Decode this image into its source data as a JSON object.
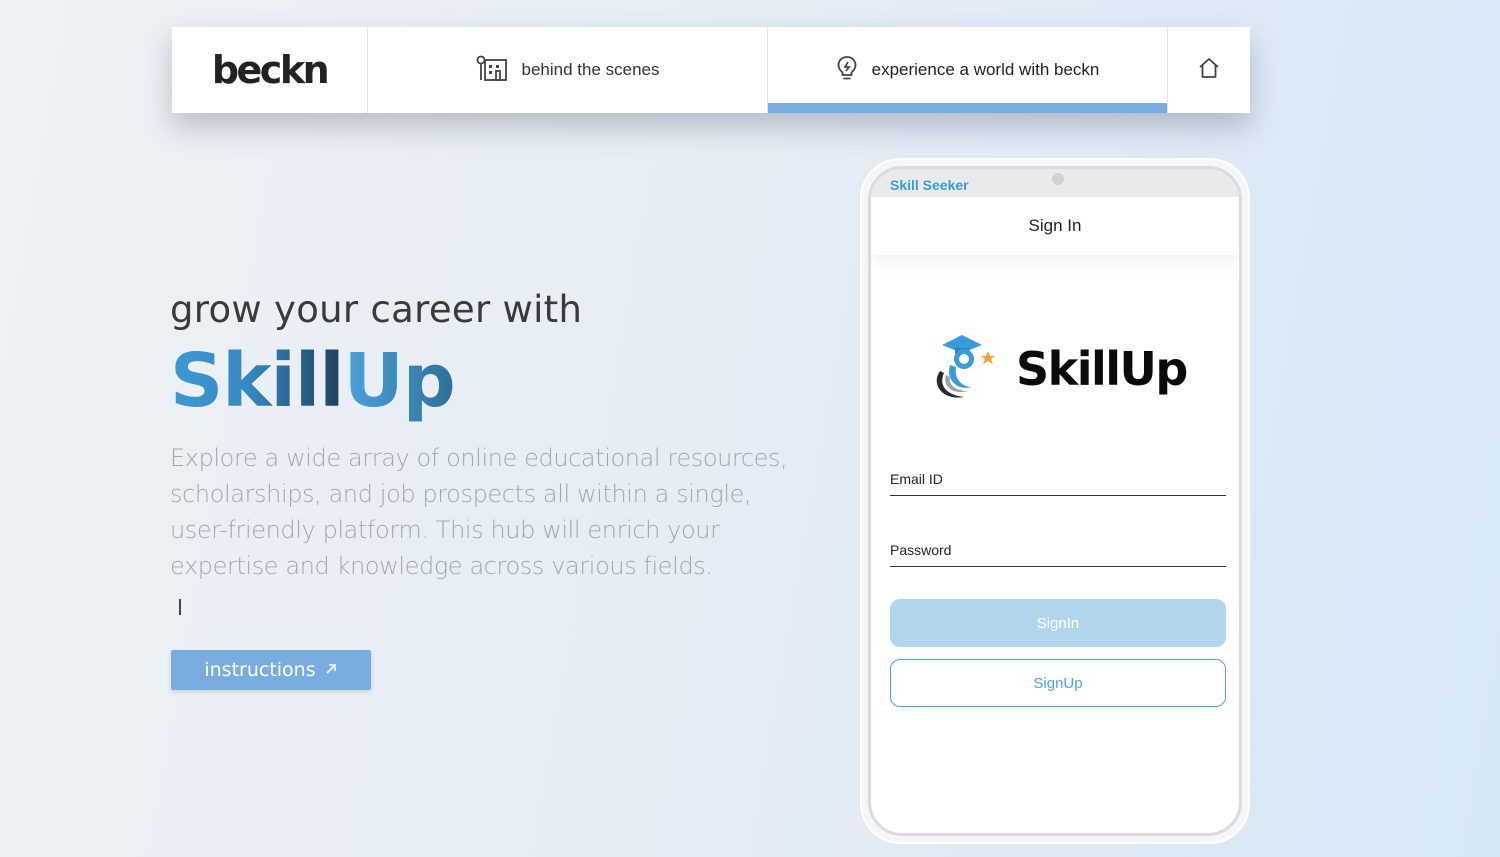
{
  "nav": {
    "logo": "beckn",
    "items": [
      {
        "label": "behind the scenes",
        "icon": "building-icon"
      },
      {
        "label": "experience a world with beckn",
        "icon": "lightbulb-icon",
        "active": true
      }
    ],
    "home_icon": "home-icon",
    "active_color": "#79ade0"
  },
  "hero": {
    "subtitle": "grow your career with",
    "brand_part1": "Skill",
    "brand_part2": "Up",
    "description": "Explore a wide array of online educational resources, scholarships, and job prospects all within a single, user-friendly platform. This hub will enrich your expertise and knowledge across various fields.",
    "instructions_label": "instructions",
    "instructions_icon": "arrow-up-right-icon"
  },
  "phone": {
    "status_title": "Skill Seeker",
    "header_title": "Sign In",
    "app_logo_text": "SkillUp",
    "email_label": "Email ID",
    "password_label": "Password",
    "signin_label": "SignIn",
    "signup_label": "SignUp",
    "brand_color": "#3b9bd8"
  }
}
